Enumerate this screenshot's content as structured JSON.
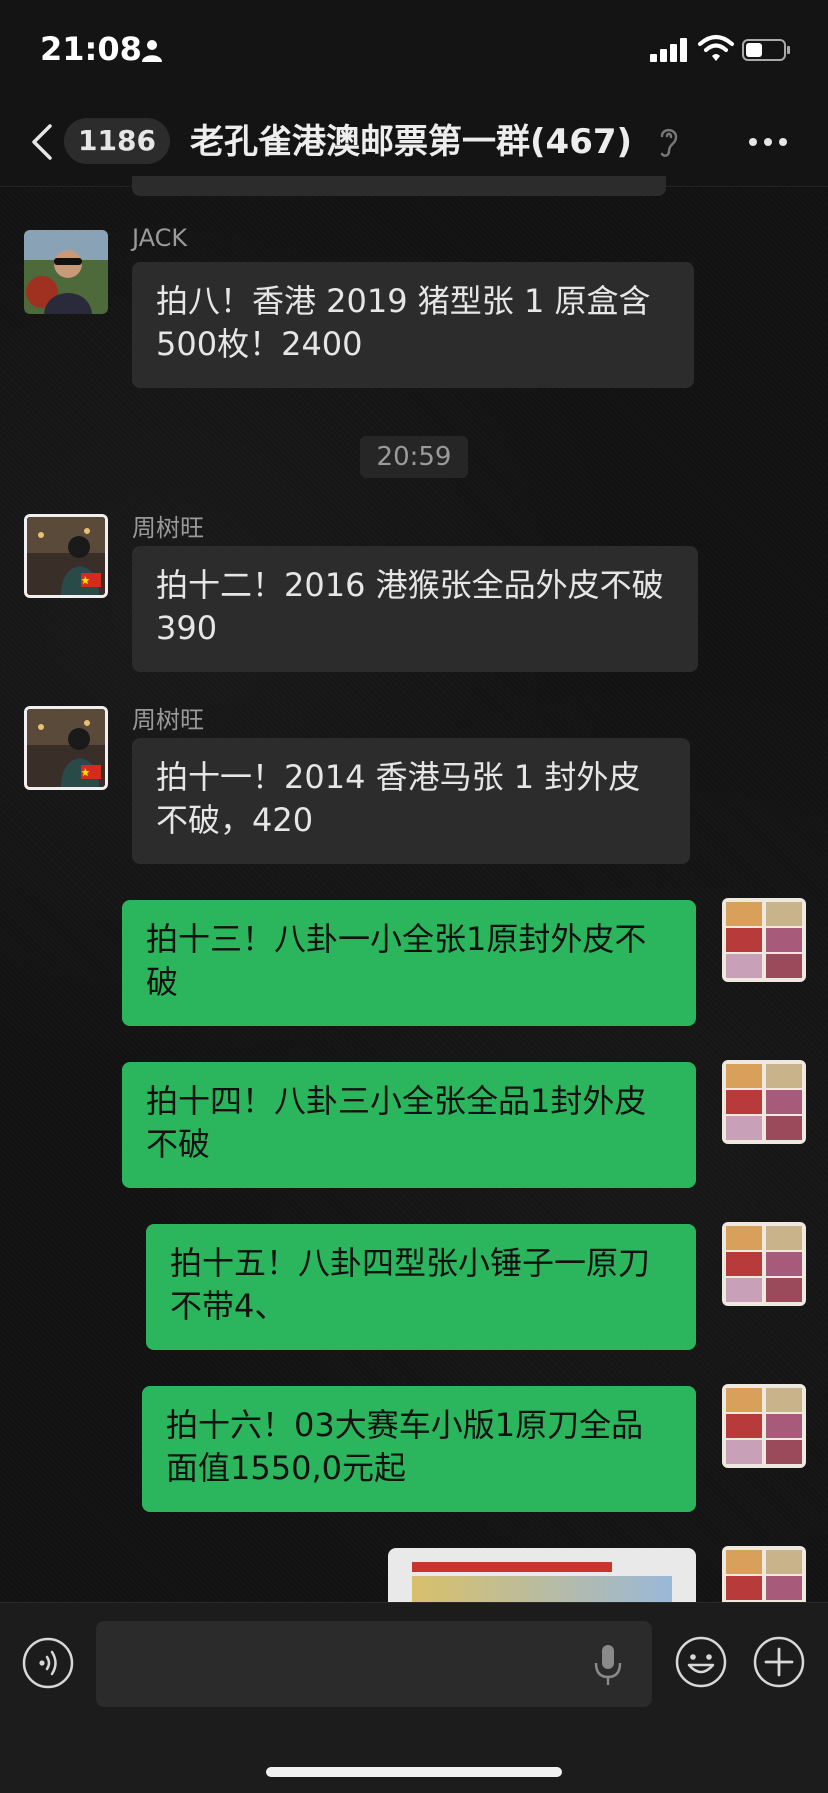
{
  "status": {
    "time": "21:08"
  },
  "nav": {
    "unread_count": "1186",
    "title": "老孔雀港澳邮票第一群(467)"
  },
  "chat": {
    "timestamp": "20:59",
    "messages": [
      {
        "sender": "JACK",
        "text": "拍八！香港 2019 猪型张 1 原盒含 500枚！2400",
        "direction": "incoming"
      },
      {
        "sender": "周树旺",
        "text": "拍十二！2016 港猴张全品外皮不破 390",
        "direction": "incoming"
      },
      {
        "sender": "周树旺",
        "text": "拍十一！2014 香港马张 1 封外皮不破，420",
        "direction": "incoming"
      },
      {
        "sender": "",
        "text": "拍十三！八卦一小全张1原封外皮不破",
        "direction": "outgoing"
      },
      {
        "sender": "",
        "text": "拍十四！八卦三小全张全品1封外皮不破",
        "direction": "outgoing"
      },
      {
        "sender": "",
        "text": "拍十五！八卦四型张小锤子一原刀不带4、",
        "direction": "outgoing"
      },
      {
        "sender": "",
        "text": "拍十六！03大赛车小版1原刀全品面值1550,0元起",
        "direction": "outgoing"
      }
    ]
  },
  "colors": {
    "outgoing_bubble": "#2bb65e",
    "incoming_bubble": "#2c2c2c",
    "background": "#111111"
  }
}
